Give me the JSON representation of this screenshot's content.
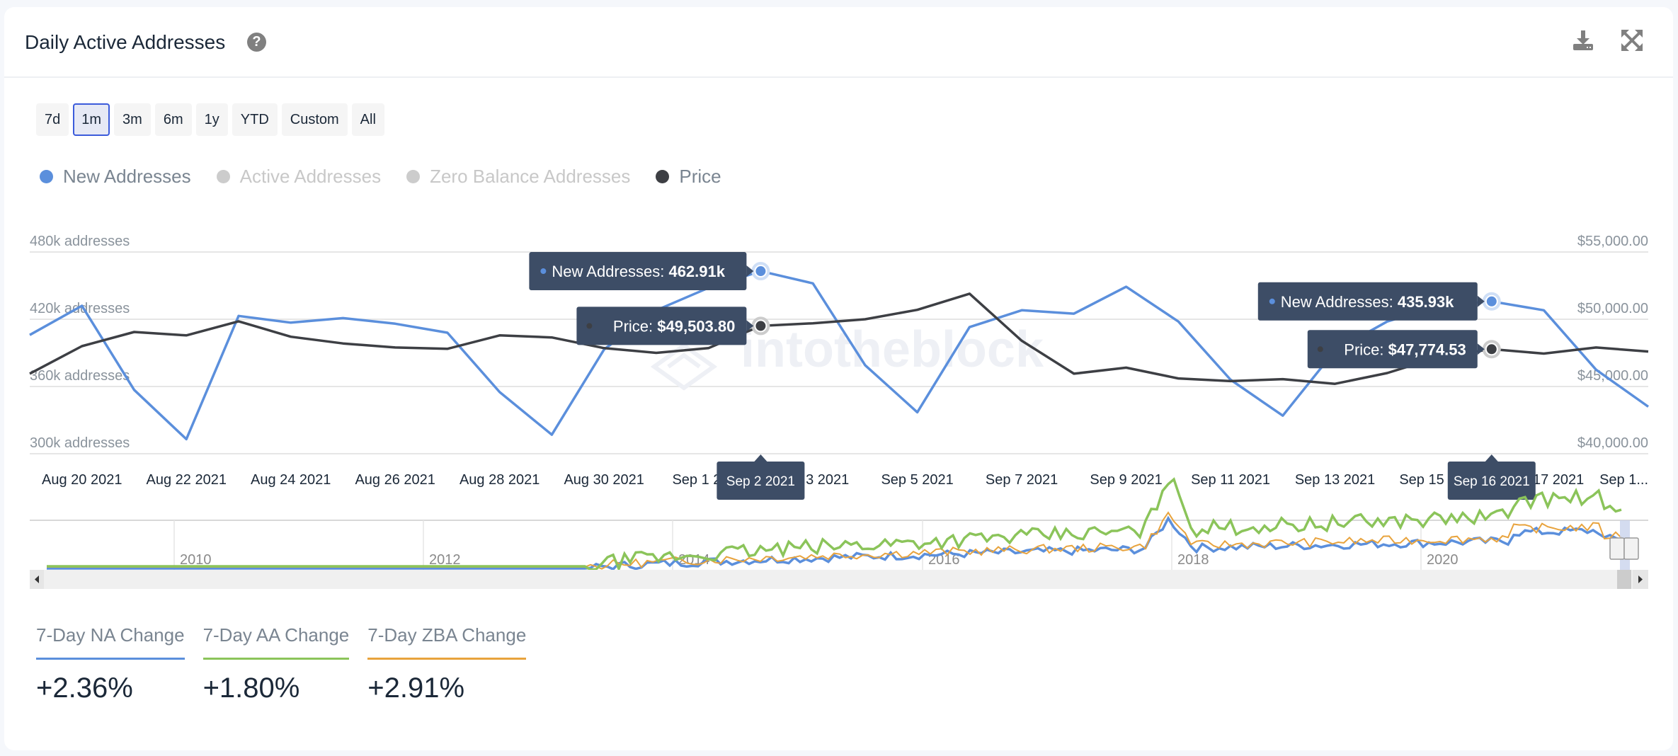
{
  "header": {
    "title": "Daily Active Addresses",
    "help_icon": "question-circle-icon",
    "download_icon": "download-icon",
    "fullscreen_icon": "expand-arrows-icon"
  },
  "range_buttons": [
    {
      "label": "7d",
      "active": false
    },
    {
      "label": "1m",
      "active": true
    },
    {
      "label": "3m",
      "active": false
    },
    {
      "label": "6m",
      "active": false
    },
    {
      "label": "1y",
      "active": false
    },
    {
      "label": "YTD",
      "active": false
    },
    {
      "label": "Custom",
      "active": false
    },
    {
      "label": "All",
      "active": false
    }
  ],
  "legend": [
    {
      "label": "New Addresses",
      "color": "#5b8fdc",
      "enabled": true
    },
    {
      "label": "Active Addresses",
      "color": "#cccccc",
      "enabled": false
    },
    {
      "label": "Zero Balance Addresses",
      "color": "#cccccc",
      "enabled": false
    },
    {
      "label": "Price",
      "color": "#3d3f44",
      "enabled": true
    }
  ],
  "watermark": "intotheblock",
  "chart_data": {
    "type": "line",
    "title": "Daily Active Addresses",
    "x": [
      "Aug 19 2021",
      "Aug 20 2021",
      "Aug 21 2021",
      "Aug 22 2021",
      "Aug 23 2021",
      "Aug 24 2021",
      "Aug 25 2021",
      "Aug 26 2021",
      "Aug 27 2021",
      "Aug 28 2021",
      "Aug 29 2021",
      "Aug 30 2021",
      "Aug 31 2021",
      "Sep 1 2021",
      "Sep 2 2021",
      "Sep 3 2021",
      "Sep 4 2021",
      "Sep 5 2021",
      "Sep 6 2021",
      "Sep 7 2021",
      "Sep 8 2021",
      "Sep 9 2021",
      "Sep 10 2021",
      "Sep 11 2021",
      "Sep 12 2021",
      "Sep 13 2021",
      "Sep 14 2021",
      "Sep 15 2021",
      "Sep 16 2021",
      "Sep 17 2021",
      "Sep 18 2021",
      "Sep 19 2021"
    ],
    "x_tick_labels": [
      "Aug 20 2021",
      "Aug 22 2021",
      "Aug 24 2021",
      "Aug 26 2021",
      "Aug 28 2021",
      "Aug 30 2021",
      "Sep 1 2021",
      "Sep 3 2021",
      "Sep 5 2021",
      "Sep 7 2021",
      "Sep 9 2021",
      "Sep 11 2021",
      "Sep 13 2021",
      "Sep 15 2021",
      "Sep 17 2021",
      "Sep 1..."
    ],
    "x_tick_indices": [
      1,
      3,
      5,
      7,
      9,
      11,
      13,
      15,
      17,
      19,
      21,
      23,
      25,
      27,
      29,
      31
    ],
    "series": [
      {
        "name": "New Addresses",
        "axis": "left",
        "unit": "k addresses",
        "color": "#5b8fdc",
        "values": [
          406,
          432,
          357,
          313,
          423,
          417,
          421,
          416,
          408,
          355,
          317,
          393,
          428,
          448,
          462.91,
          452,
          379,
          337,
          413,
          428,
          425,
          449,
          418,
          366,
          334,
          392,
          418,
          432,
          435.93,
          428,
          375,
          342
        ]
      },
      {
        "name": "Price",
        "axis": "right",
        "unit": "USD",
        "color": "#3d3f44",
        "values": [
          45950,
          48000,
          49050,
          48800,
          49850,
          48700,
          48200,
          47900,
          47800,
          48800,
          48650,
          47850,
          47500,
          47850,
          49503.8,
          49700,
          50000,
          50700,
          51900,
          48400,
          45950,
          46400,
          45600,
          45400,
          45550,
          45200,
          46000,
          47200,
          47774.53,
          47450,
          47900,
          47600
        ]
      }
    ],
    "y_left": {
      "ticks": [
        300,
        360,
        420,
        480
      ],
      "tick_labels": [
        "300k addresses",
        "360k addresses",
        "420k addresses",
        "480k addresses"
      ],
      "range": [
        300,
        480
      ]
    },
    "y_right": {
      "ticks": [
        40000,
        45000,
        50000,
        55000
      ],
      "tick_labels": [
        "$40,000.00",
        "$45,000.00",
        "$50,000.00",
        "$55,000.00"
      ],
      "range": [
        40000,
        55000
      ]
    },
    "grid": true,
    "legend_position": "top-left",
    "tooltips": [
      {
        "index": 14,
        "date": "Sep 2 2021",
        "new_addresses_label": "New Addresses: ",
        "new_addresses_value": "462.91k",
        "price_label": "Price: ",
        "price_value": "$49,503.80"
      },
      {
        "index": 28,
        "date": "Sep 16 2021",
        "new_addresses_label": "New Addresses: ",
        "new_addresses_value": "435.93k",
        "price_label": "Price: ",
        "price_value": "$47,774.53"
      }
    ]
  },
  "navigator": {
    "year_labels": [
      "2010",
      "2012",
      "2014",
      "2016",
      "2018",
      "2020"
    ],
    "series_colors": {
      "active": "#8bc45a",
      "zero_balance": "#e8a33d",
      "new": "#5b8fdc"
    },
    "left_arrow": "left-arrow-icon",
    "right_arrow": "right-arrow-icon"
  },
  "stats": [
    {
      "label": "7-Day NA Change",
      "value": "+2.36%",
      "color": "#5b8fdc"
    },
    {
      "label": "7-Day AA Change",
      "value": "+1.80%",
      "color": "#8bc45a"
    },
    {
      "label": "7-Day ZBA Change",
      "value": "+2.91%",
      "color": "#e8a33d"
    }
  ]
}
